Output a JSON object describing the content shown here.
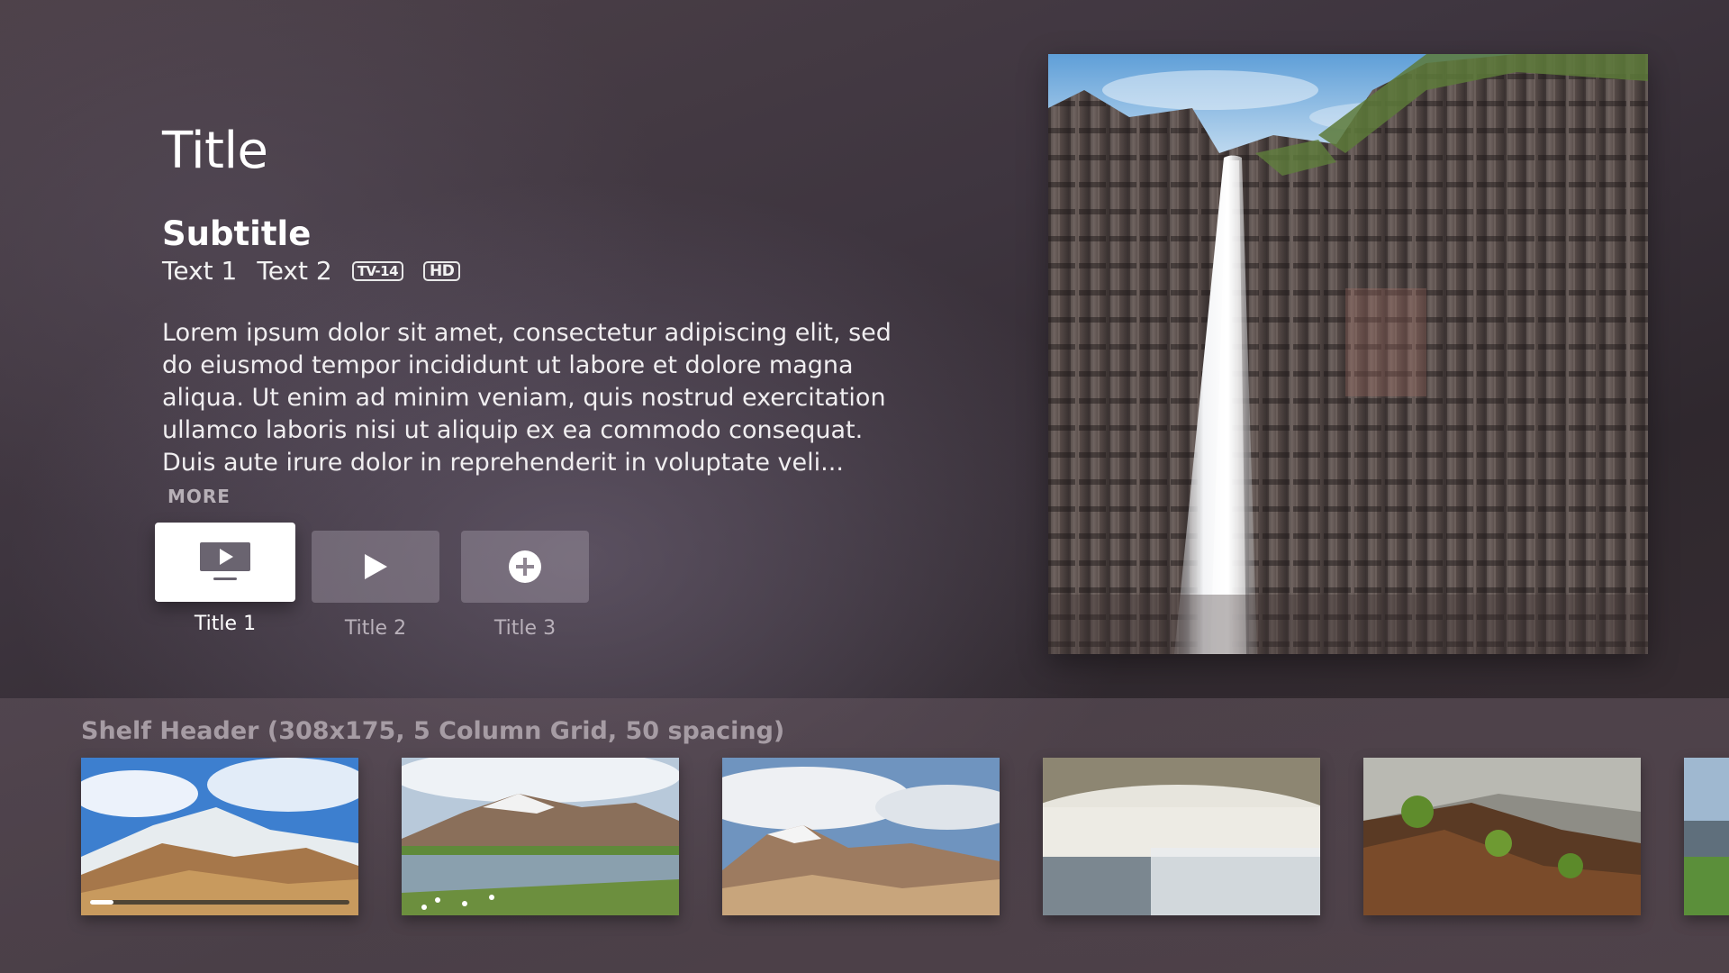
{
  "product": {
    "title": "Title",
    "subtitle": "Subtitle",
    "meta_text_1": "Text 1",
    "meta_text_2": "Text 2",
    "rating_badge": "TV-14",
    "quality_badge": "HD",
    "description": "Lorem ipsum dolor sit amet, consectetur adipiscing elit, sed do eiusmod tempor incididunt ut labore et dolore magna aliqua. Ut enim ad minim veniam, quis nostrud exercitation ullamco laboris nisi ut aliquip ex ea commodo consequat. Duis aute irure dolor in reprehenderit in voluptate veli...",
    "more_label": "MORE"
  },
  "actions": [
    {
      "label": "Title 1",
      "icon": "tv-play-icon",
      "focused": true
    },
    {
      "label": "Title 2",
      "icon": "play-icon",
      "focused": false
    },
    {
      "label": "Title 3",
      "icon": "add-circle-icon",
      "focused": false
    }
  ],
  "hero": {
    "image": "waterfall-basalt-cliff"
  },
  "shelf": {
    "header": "Shelf Header (308x175, 5 Column Grid, 50 spacing)",
    "items": [
      {
        "image": "snowy-mountain-sky",
        "progress": 0.09
      },
      {
        "image": "mountain-lake-reflection"
      },
      {
        "image": "mountain-clouds"
      },
      {
        "image": "misty-waterfall"
      },
      {
        "image": "mossy-rocks-river"
      },
      {
        "image": "partial-landscape"
      }
    ]
  },
  "colors": {
    "background": "#3e353f",
    "focused_button": "#ffffff",
    "unfocused_button": "#7a6f7c",
    "dim_text": "#b9b1ba",
    "shelf_header_text": "#a69ca4"
  }
}
